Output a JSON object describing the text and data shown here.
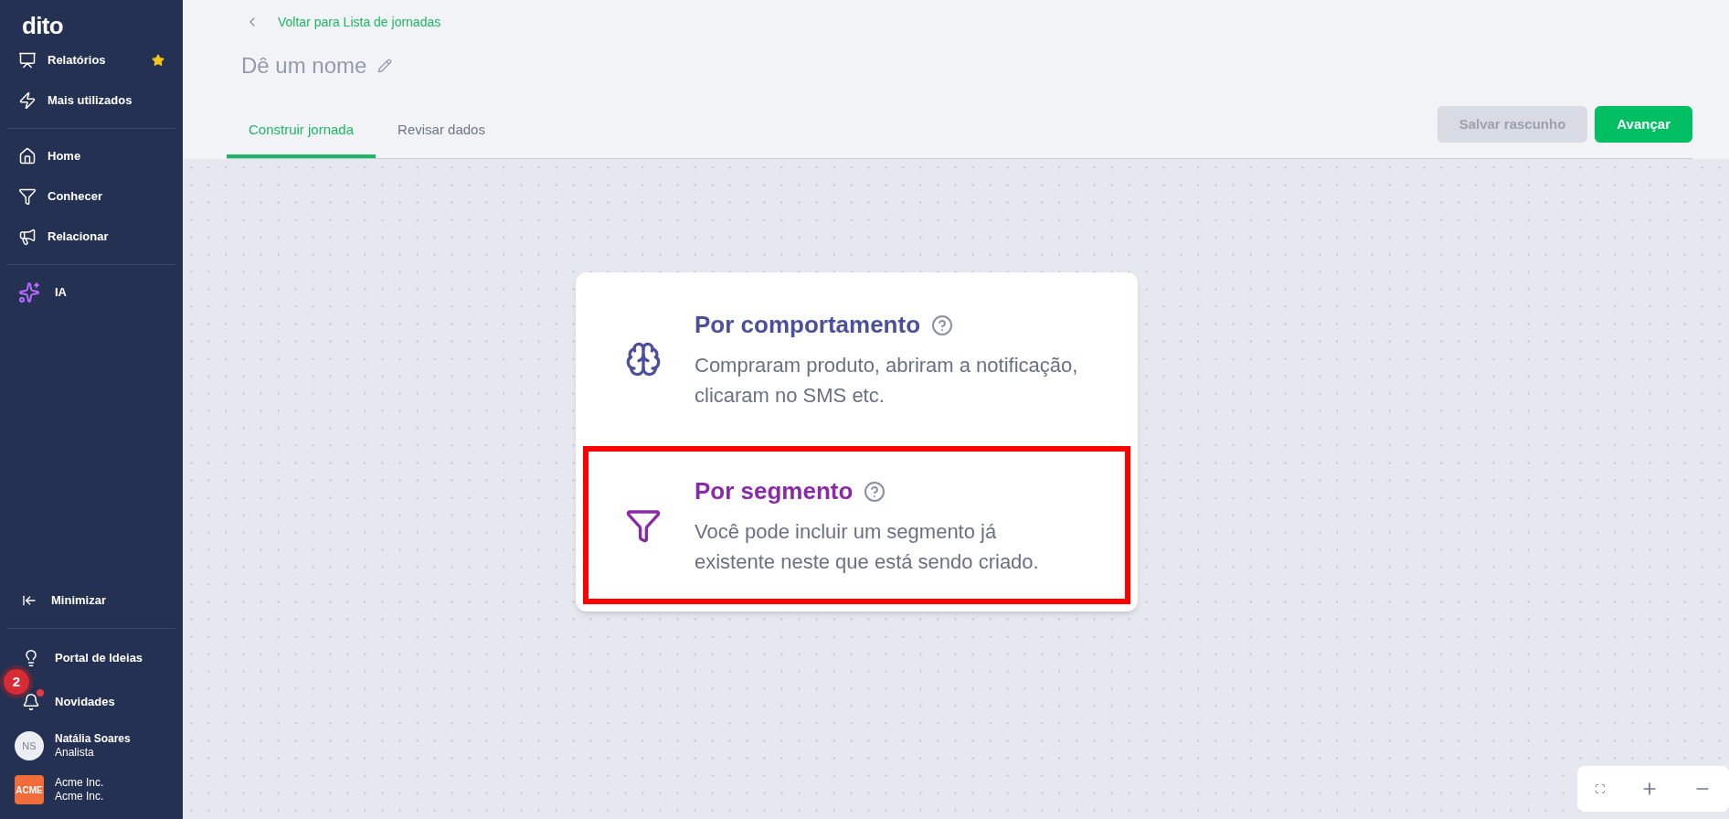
{
  "sidebar": {
    "logo": "dito",
    "top_items": [
      {
        "label": "Relatórios",
        "starred": true
      },
      {
        "label": "Mais utilizados",
        "starred": false
      }
    ],
    "main_items": [
      {
        "label": "Home"
      },
      {
        "label": "Conhecer"
      },
      {
        "label": "Relacionar"
      }
    ],
    "ai_item": {
      "label": "IA"
    },
    "minimize": {
      "label": "Minimizar"
    },
    "bottom_items": [
      {
        "label": "Portal de Ideias",
        "unread": false
      },
      {
        "label": "Novidades",
        "unread": true,
        "badge": "2"
      }
    ],
    "user": {
      "initials": "NS",
      "name": "Natália Soares",
      "role": "Analista"
    },
    "company": {
      "logo": "ACME",
      "name": "Acme Inc.",
      "subtitle": "Acme Inc."
    }
  },
  "header": {
    "back_link": "Voltar para Lista de jornadas",
    "title_placeholder": "Dê um nome",
    "tabs": [
      {
        "label": "Construir jornada",
        "selected": true
      },
      {
        "label": "Revisar dados",
        "selected": false
      }
    ],
    "buttons": [
      {
        "label": "Salvar rascunho",
        "disabled": true
      },
      {
        "label": "Avançar",
        "disabled": false
      }
    ]
  },
  "options": [
    {
      "kind": "behavior",
      "title": "Por comportamento",
      "description": "Compraram produto, abriram a notificação, clicaram no SMS etc.",
      "color": "#4b4f9c",
      "highlighted": false
    },
    {
      "kind": "segment",
      "title": "Por segmento",
      "description": "Você pode incluir um segmento já existente neste que está sendo criado.",
      "color": "#8a2aa8",
      "highlighted": true
    }
  ]
}
